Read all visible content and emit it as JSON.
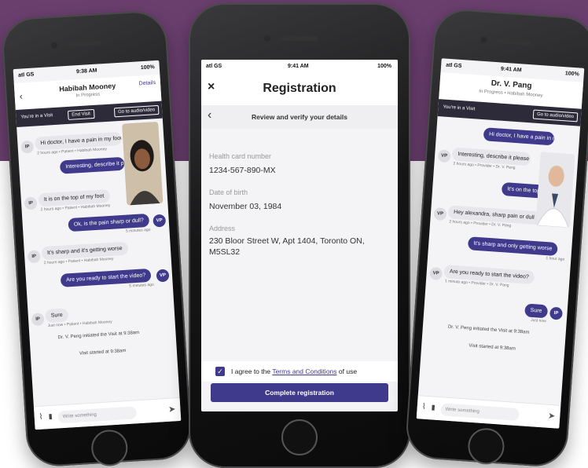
{
  "left_phone": {
    "status": {
      "carrier": "atl GS",
      "time": "9:38 AM",
      "battery": "100%"
    },
    "header": {
      "title": "Habibah Mooney",
      "subtitle": "In Progress",
      "details_link": "Details"
    },
    "visit_bar": {
      "label": "You're in a Visit",
      "end_button": "End Visit",
      "av_button": "Go to audio/video"
    },
    "messages": [
      {
        "side": "in",
        "avatar": "IP",
        "text": "Hi doctor, I have a pain in my foot",
        "meta": "2 hours ago • Patient • Habibah Mooney"
      },
      {
        "side": "out",
        "avatar": "VP",
        "text": "Interesting, describe it please",
        "meta": ""
      },
      {
        "side": "in",
        "avatar": "IP",
        "text": "It is on the top of my foot",
        "meta": "2 hours ago • Patient • Habibah Mooney"
      },
      {
        "side": "out",
        "avatar": "VP",
        "text": "Ok, is the pain sharp or dull?",
        "meta": "5 minutes ago"
      },
      {
        "side": "in",
        "avatar": "IP",
        "text": "It's sharp and it's getting worse",
        "meta": "2 hours ago • Patient • Habibah Mooney"
      },
      {
        "side": "out",
        "avatar": "VP",
        "text": "Are you ready to start the video?",
        "meta": "5 minutes ago"
      },
      {
        "side": "in",
        "avatar": "IP",
        "text": "Sure",
        "meta": "Just now • Patient • Habibah Mooney"
      }
    ],
    "system": [
      "Dr. V. Peng initiated the Visit at 9:38am",
      "Visit started at 9:38am"
    ],
    "composer_placeholder": "Write something"
  },
  "middle_phone": {
    "status": {
      "carrier": "atl GS",
      "time": "9:41 AM",
      "battery": "100%"
    },
    "title": "Registration",
    "close_icon": "×",
    "back_icon": "‹",
    "subheader": "Review and verify your details",
    "fields": [
      {
        "label": "Health card number",
        "value": "1234-567-890-MX"
      },
      {
        "label": "Date of birth",
        "value": "November 03, 1984"
      },
      {
        "label": "Address",
        "value": "230 Bloor Street W, Apt 1404, Toronto ON, M5SL32"
      }
    ],
    "agree": {
      "prefix": "I agree to the ",
      "link": "Terms and Conditions",
      "suffix": " of use",
      "checked": true
    },
    "submit_button": "Complete registration"
  },
  "right_phone": {
    "status": {
      "carrier": "atl GS",
      "time": "9:41 AM",
      "battery": "100%"
    },
    "header": {
      "title": "Dr. V. Pang",
      "subtitle": "In Progress • Habibah Mooney"
    },
    "visit_bar": {
      "label": "You're in a Visit",
      "av_button": "Go to audio/video"
    },
    "messages": [
      {
        "side": "out",
        "avatar": "",
        "text": "Hi doctor, I have a pain in my foot",
        "meta": ""
      },
      {
        "side": "in",
        "avatar": "VP",
        "text": "Interesting, describe it please",
        "meta": "2 hours ago • Provider • Dr. V. Pang"
      },
      {
        "side": "out",
        "avatar": "",
        "text": "It's on the top of my foot",
        "meta": ""
      },
      {
        "side": "in",
        "avatar": "VP",
        "text": "Hey alexandra, sharp pain or dull pain?",
        "meta": "2 hours ago • Provider • Dr. V. Pang"
      },
      {
        "side": "out",
        "avatar": "",
        "text": "It's sharp and only getting worse",
        "meta": "1 hour ago"
      },
      {
        "side": "in",
        "avatar": "VP",
        "text": "Are you ready to start the video?",
        "meta": "1 minute ago • Provider • Dr. V. Pang"
      },
      {
        "side": "out",
        "avatar": "IP",
        "text": "Sure",
        "meta": "Just now"
      }
    ],
    "system": [
      "Dr. V. Peng initiated the Visit at 9:38am",
      "Visit started at 9:38am"
    ],
    "composer_placeholder": "Write something"
  },
  "colors": {
    "brand": "#3f3a8c",
    "background_band": "#6a3f6e",
    "screen": "#f4f3f6"
  }
}
